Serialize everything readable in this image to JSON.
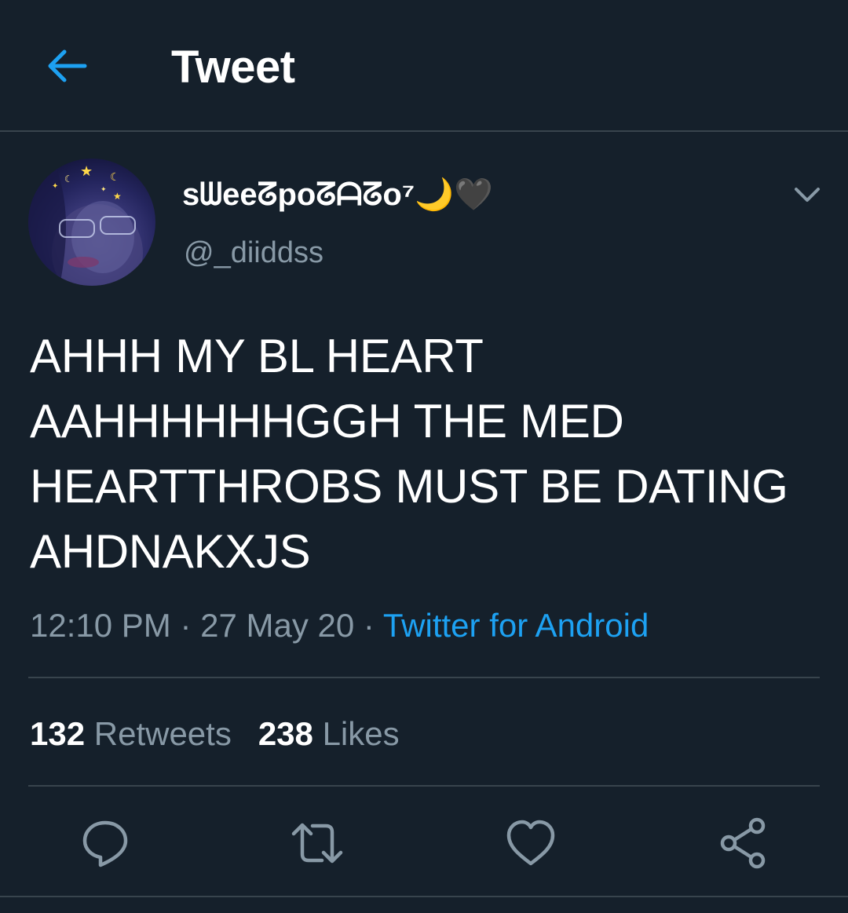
{
  "header": {
    "title": "Tweet",
    "back_icon": "arrow-left-icon",
    "accent_color": "#1da1f2"
  },
  "tweet": {
    "display_name": "sᗯeeᘔpoᘔᗩᘔo⁷🌙🖤",
    "handle": "@_diiddss",
    "text_lines": [
      "AHHH MY BL HEART",
      "AAHHHHHHGGH THE MED",
      "HEARTTHROBS MUST BE DATING",
      "AHDNAKXJS"
    ],
    "time": "12:10 PM",
    "date": "27 May 20",
    "separator": "·",
    "source": "Twitter for Android"
  },
  "stats": {
    "retweets_count": "132",
    "retweets_label": "Retweets",
    "likes_count": "238",
    "likes_label": "Likes"
  },
  "actions": {
    "reply_icon": "reply-icon",
    "retweet_icon": "retweet-icon",
    "like_icon": "heart-icon",
    "share_icon": "share-icon"
  },
  "colors": {
    "background": "#15202b",
    "secondary_text": "#8899a6",
    "divider": "#38444d",
    "link": "#1da1f2"
  }
}
